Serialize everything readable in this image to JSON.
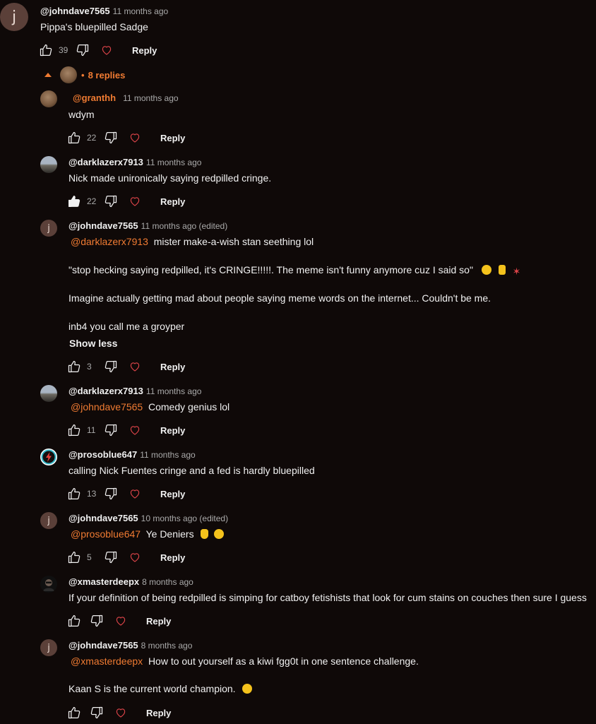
{
  "top_comment": {
    "author": "@johndave7565",
    "time": "11 months ago",
    "avatar_letter": "j",
    "text": "Pippa's bluepilled Sadge",
    "likes": "39",
    "reply_label": "Reply"
  },
  "replies_toggle": {
    "label": "8 replies",
    "separator": "•"
  },
  "replies": [
    {
      "author": "@granthh",
      "time": "11 months ago",
      "text": "wdym",
      "likes": "22",
      "reply_label": "Reply",
      "liked": false
    },
    {
      "author": "@darklazerx7913",
      "time": "11 months ago",
      "text": "Nick made unironically saying redpilled cringe.",
      "likes": "22",
      "reply_label": "Reply",
      "liked": true
    },
    {
      "author": "@johndave7565",
      "time": "11 months ago (edited)",
      "avatar_letter": "j",
      "mention": "@darklazerx7913",
      "line1": "mister make-a-wish stan seething lol",
      "line2": "\"stop hecking saying redpilled, it's CRINGE!!!!!. The meme isn't funny anymore cuz I said so\"",
      "line3": "Imagine actually getting mad about people saying meme words on the internet... Couldn't be me.",
      "line4": "inb4 you call me a groyper",
      "show_less": "Show less",
      "likes": "3",
      "reply_label": "Reply"
    },
    {
      "author": "@darklazerx7913",
      "time": "11 months ago",
      "mention": "@johndave7565",
      "text": "Comedy genius lol",
      "likes": "11",
      "reply_label": "Reply"
    },
    {
      "author": "@prosoblue647",
      "time": "11 months ago",
      "text": "calling Nick Fuentes cringe and a fed is hardly bluepilled",
      "likes": "13",
      "reply_label": "Reply"
    },
    {
      "author": "@johndave7565",
      "time": "10 months ago (edited)",
      "avatar_letter": "j",
      "mention": "@prosoblue647",
      "text": "Ye Deniers",
      "likes": "5",
      "reply_label": "Reply"
    },
    {
      "author": "@xmasterdeepx",
      "time": "8 months ago",
      "text": "If your definition of being redpilled is simping for catboy fetishists that look for cum stains on couches then sure I guess",
      "likes": "",
      "reply_label": "Reply"
    },
    {
      "author": "@johndave7565",
      "time": "8 months ago",
      "avatar_letter": "j",
      "mention": "@xmasterdeepx",
      "line1": "How to out yourself as a kiwi fgg0t in one sentence challenge.",
      "line2": "Kaan S is the current world champion.",
      "likes": "",
      "reply_label": "Reply"
    }
  ],
  "colors": {
    "background": "#0f0908",
    "accent": "#f07b32",
    "text": "#f1f1f1",
    "muted": "#aaaaaa"
  }
}
